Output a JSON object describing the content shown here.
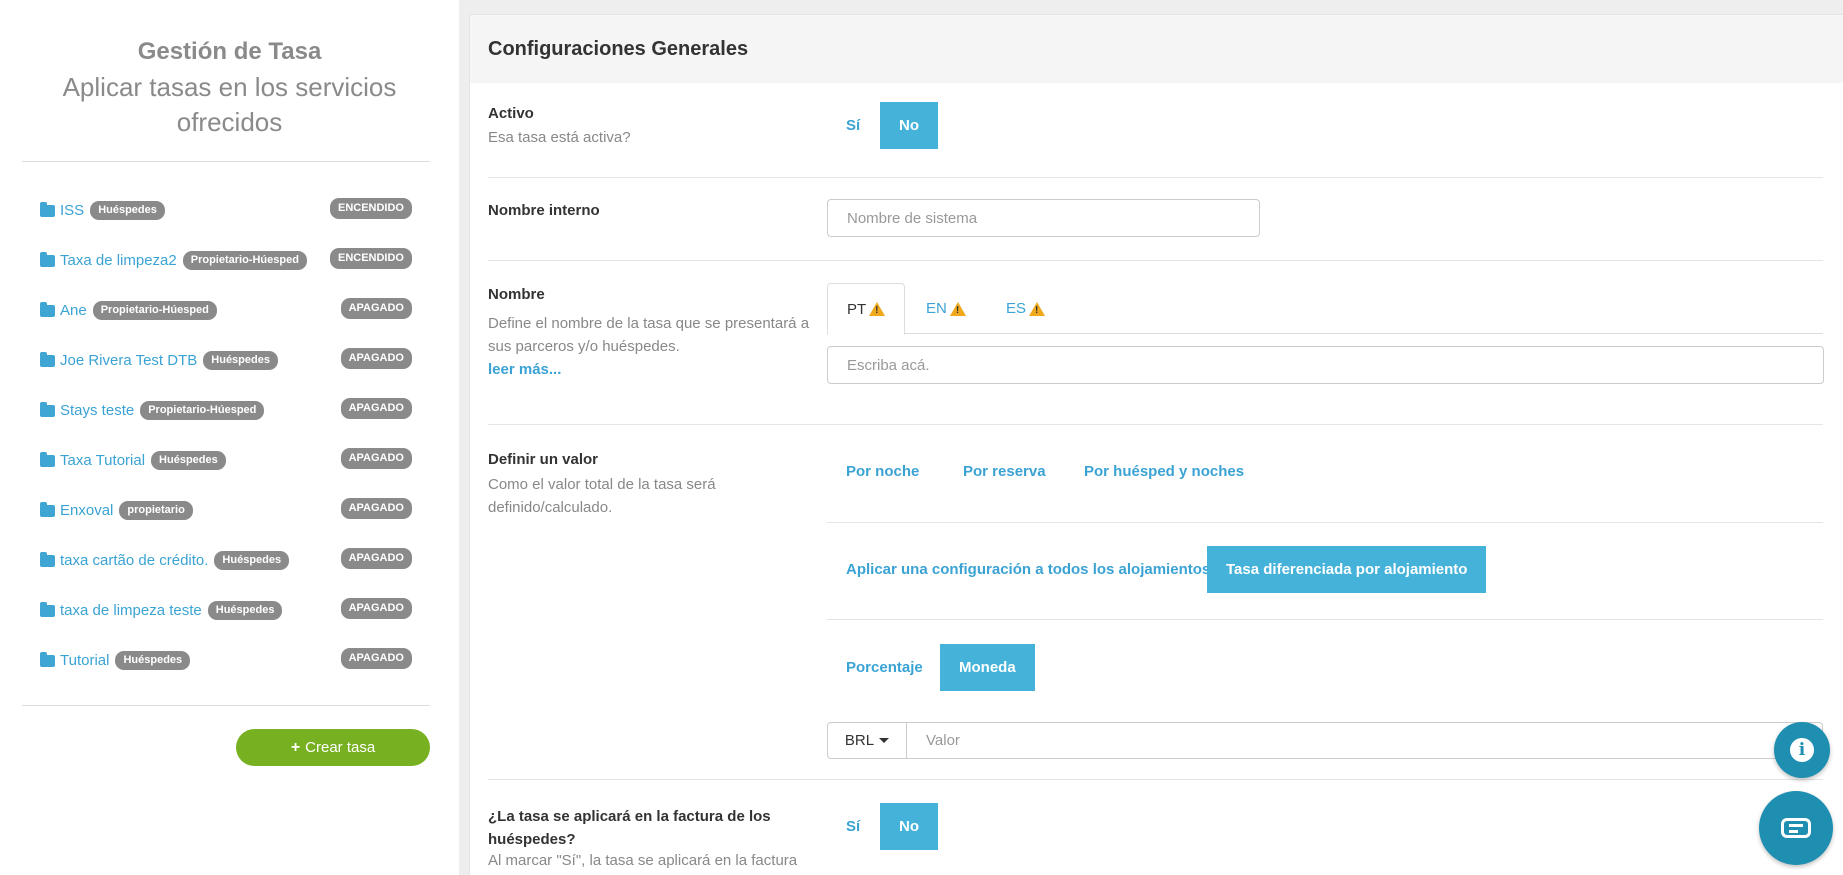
{
  "sidebar": {
    "title": "Gestión de Tasa",
    "subtitle": "Aplicar tasas en los servicios ofrecidos",
    "rates": [
      {
        "name": "ISS",
        "tag": "Huéspedes",
        "state": "ENCENDIDO"
      },
      {
        "name": "Taxa de limpeza2",
        "tag": "Propietario-Húesped",
        "state": "ENCENDIDO"
      },
      {
        "name": "Ane",
        "tag": "Propietario-Húesped",
        "state": "APAGADO"
      },
      {
        "name": "Joe Rivera Test DTB",
        "tag": "Huéspedes",
        "state": "APAGADO"
      },
      {
        "name": "Stays teste",
        "tag": "Propietario-Húesped",
        "state": "APAGADO"
      },
      {
        "name": "Taxa Tutorial",
        "tag": "Huéspedes",
        "state": "APAGADO"
      },
      {
        "name": "Enxoval",
        "tag": "propietario",
        "state": "APAGADO"
      },
      {
        "name": "taxa cartão de crédito.",
        "tag": "Huéspedes",
        "state": "APAGADO"
      },
      {
        "name": "taxa de limpeza teste",
        "tag": "Huéspedes",
        "state": "APAGADO"
      },
      {
        "name": "Tutorial",
        "tag": "Huéspedes",
        "state": "APAGADO"
      }
    ],
    "create_label": "Crear tasa"
  },
  "panel": {
    "title": "Configuraciones Generales",
    "active": {
      "label": "Activo",
      "desc": "Esa tasa está activa?",
      "yes": "Sí",
      "no": "No",
      "selected": "No"
    },
    "internal_name": {
      "label": "Nombre interno",
      "placeholder": "Nombre de sistema",
      "value": ""
    },
    "name": {
      "label": "Nombre",
      "desc": "Define el nombre de la tasa que se presentará a sus parceros y/o huéspedes.",
      "more": "leer más...",
      "tabs": [
        "PT",
        "EN",
        "ES"
      ],
      "active_tab": "PT",
      "placeholder": "Escriba acá."
    },
    "value": {
      "label": "Definir un valor",
      "desc": "Como el valor total de la tasa será definido/calculado.",
      "modes": [
        "Por noche",
        "Por reserva",
        "Por huésped y noches"
      ],
      "scope": [
        "Aplicar una configuración a todos los alojamientos",
        "Tasa diferenciada por alojamiento"
      ],
      "scope_selected": "Tasa diferenciada por alojamiento",
      "type": [
        "Porcentaje",
        "Moneda"
      ],
      "type_selected": "Moneda",
      "currency": "BRL",
      "placeholder": "Valor"
    },
    "invoice": {
      "label": "¿La tasa se aplicará en la factura de los huéspedes?",
      "desc": "Al marcar \"Sí\", la tasa se aplicará en la factura",
      "yes": "Sí",
      "no": "No",
      "selected": "No"
    }
  },
  "colors": {
    "accent": "#45b2d9",
    "link": "#3aa3d4",
    "create": "#77b021",
    "badge": "#8a8a8a",
    "warning": "#f0a81c"
  },
  "icons": {
    "folder": "folder-icon",
    "warning": "warning-icon",
    "info": "info-icon",
    "chat": "chat-icon",
    "plus": "plus-icon",
    "caret": "caret-down-icon"
  }
}
